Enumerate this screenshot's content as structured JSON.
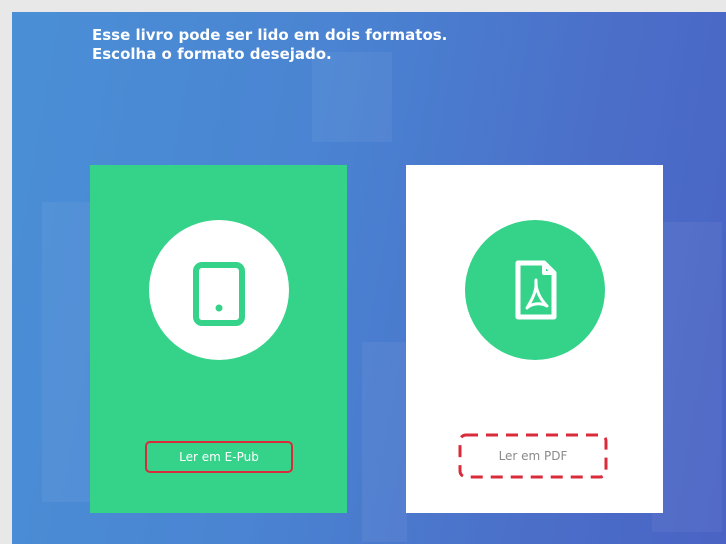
{
  "heading": {
    "line1": "Esse livro pode ser lido em dois formatos.",
    "line2": "Escolha o formato desejado."
  },
  "options": {
    "epub": {
      "label": "Ler em E-Pub",
      "icon": "tablet-icon"
    },
    "pdf": {
      "label": "Ler em PDF",
      "icon": "pdf-file-icon"
    }
  },
  "colors": {
    "accent_green": "#35d28a",
    "highlight_red": "#d92b3a",
    "background_blue": "#4a84d2"
  }
}
